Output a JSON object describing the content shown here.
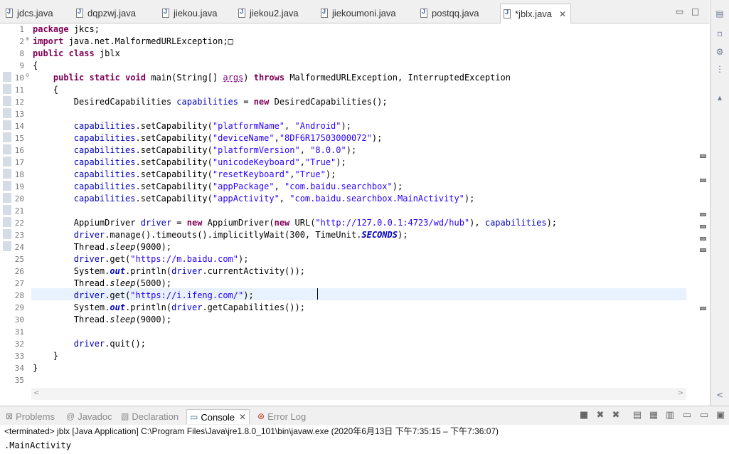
{
  "editor_tabs": [
    {
      "label": "jdcs.java"
    },
    {
      "label": "dqpzwj.java"
    },
    {
      "label": "jiekou.java"
    },
    {
      "label": "jiekou2.java"
    },
    {
      "label": "jiekoumoni.java"
    },
    {
      "label": "postqq.java"
    },
    {
      "label": "*jblx.java",
      "active": true
    }
  ],
  "editor_controls": {
    "minimize": "▭",
    "maximize": "□",
    "close_tab": "✕"
  },
  "code_lines": [
    {
      "n": "1",
      "text": "package jkcs;"
    },
    {
      "n": "2",
      "text": "import java.net.MalformedURLException;□"
    },
    {
      "n": "8",
      "text": "public class jblx"
    },
    {
      "n": "9",
      "text": "{"
    },
    {
      "n": "10",
      "text": "    public static void main(String[] args) throws MalformedURLException, InterruptedException"
    },
    {
      "n": "11",
      "text": "    {"
    },
    {
      "n": "12",
      "text": "        DesiredCapabilities capabilities = new DesiredCapabilities();"
    },
    {
      "n": "13",
      "text": ""
    },
    {
      "n": "14",
      "text": "        capabilities.setCapability(\"platformName\", \"Android\");"
    },
    {
      "n": "15",
      "text": "        capabilities.setCapability(\"deviceName\",\"8DF6R17503000072\");"
    },
    {
      "n": "16",
      "text": "        capabilities.setCapability(\"platformVersion\", \"8.0.0\");"
    },
    {
      "n": "17",
      "text": "        capabilities.setCapability(\"unicodeKeyboard\",\"True\");"
    },
    {
      "n": "18",
      "text": "        capabilities.setCapability(\"resetKeyboard\",\"True\");"
    },
    {
      "n": "19",
      "text": "        capabilities.setCapability(\"appPackage\", \"com.baidu.searchbox\");"
    },
    {
      "n": "20",
      "text": "        capabilities.setCapability(\"appActivity\", \"com.baidu.searchbox.MainActivity\");"
    },
    {
      "n": "21",
      "text": ""
    },
    {
      "n": "22",
      "text": "        AppiumDriver driver = new AppiumDriver(new URL(\"http://127.0.0.1:4723/wd/hub\"), capabilities);"
    },
    {
      "n": "23",
      "text": "        driver.manage().timeouts().implicitlyWait(300, TimeUnit.SECONDS);"
    },
    {
      "n": "24",
      "text": "        Thread.sleep(9000);"
    },
    {
      "n": "25",
      "text": "        driver.get(\"https://m.baidu.com\");"
    },
    {
      "n": "26",
      "text": "        System.out.println(driver.currentActivity());"
    },
    {
      "n": "27",
      "text": "        Thread.sleep(5000);"
    },
    {
      "n": "28",
      "text": "        driver.get(\"https://i.ifeng.com/\");"
    },
    {
      "n": "29",
      "text": "        System.out.println(driver.getCapabilities());"
    },
    {
      "n": "30",
      "text": "        Thread.sleep(9000);"
    },
    {
      "n": "31",
      "text": ""
    },
    {
      "n": "32",
      "text": "        driver.quit();"
    },
    {
      "n": "33",
      "text": "    }"
    },
    {
      "n": "34",
      "text": "}"
    },
    {
      "n": "35",
      "text": ""
    }
  ],
  "bottom_tabs": [
    {
      "label": "Problems",
      "icon": "problems-icon"
    },
    {
      "label": "Javadoc",
      "icon": "javadoc-icon"
    },
    {
      "label": "Declaration",
      "icon": "declaration-icon"
    },
    {
      "label": "Console",
      "icon": "console-icon",
      "active": true
    },
    {
      "label": "Error Log",
      "icon": "error-log-icon"
    }
  ],
  "console": {
    "header": "<terminated> jblx [Java Application] C:\\Program Files\\Java\\jre1.8.0_101\\bin\\javaw.exe  (2020年6月13日 下午7:35:15 – 下午7:36:07)",
    "output": ".MainActivity"
  }
}
